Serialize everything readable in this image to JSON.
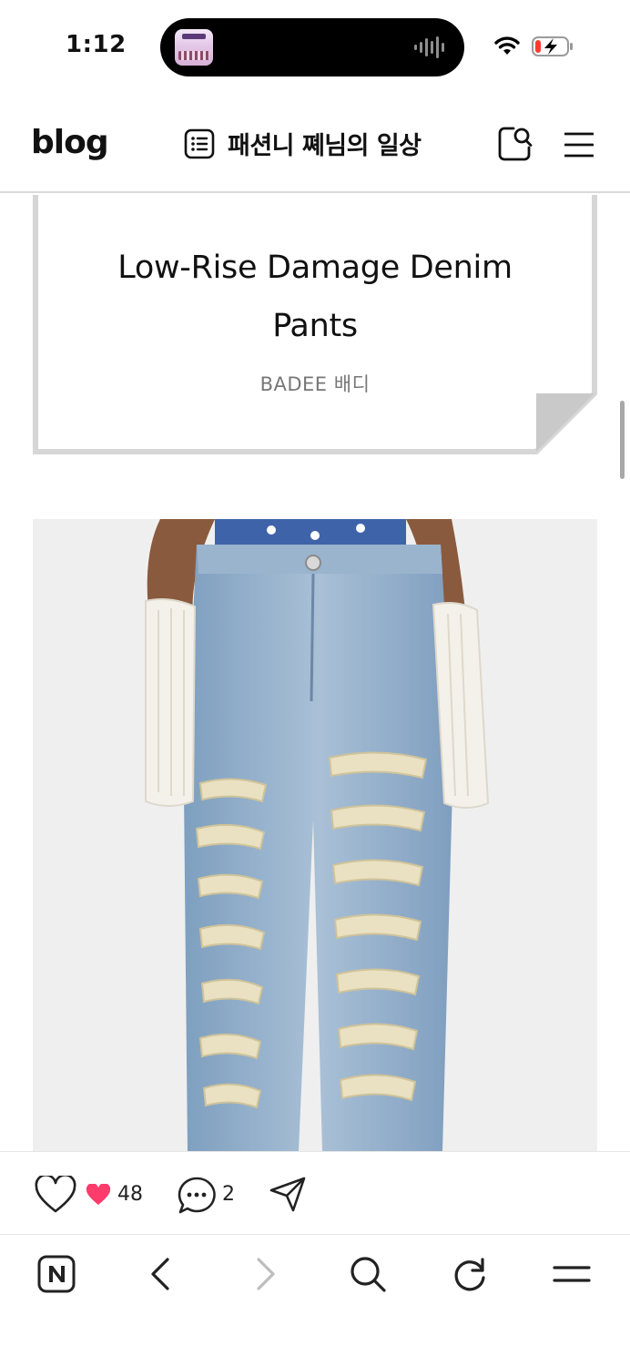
{
  "status_bar": {
    "time": "1:12"
  },
  "header": {
    "logo": "blog",
    "blog_title": "패션니 쪠님의 일상"
  },
  "post": {
    "title_line1": "Low-Rise Damage Denim",
    "title_line2": "Pants",
    "subtitle": "BADEE 배디"
  },
  "reactions": {
    "like_count": "48",
    "comment_count": "2"
  },
  "colors": {
    "accent_heart": "#ff3b6b",
    "divider": "#d9d9d9",
    "card_border": "#d6d6d6"
  },
  "icons": {
    "header": [
      "list-icon",
      "search-people-icon",
      "hamburger-icon"
    ],
    "reaction_bar": [
      "like-icon",
      "heart-icon",
      "comment-icon",
      "share-icon"
    ],
    "bottom_nav": [
      "naver-n-icon",
      "back-icon",
      "forward-icon",
      "search-icon",
      "reload-icon",
      "menu-icon"
    ]
  }
}
